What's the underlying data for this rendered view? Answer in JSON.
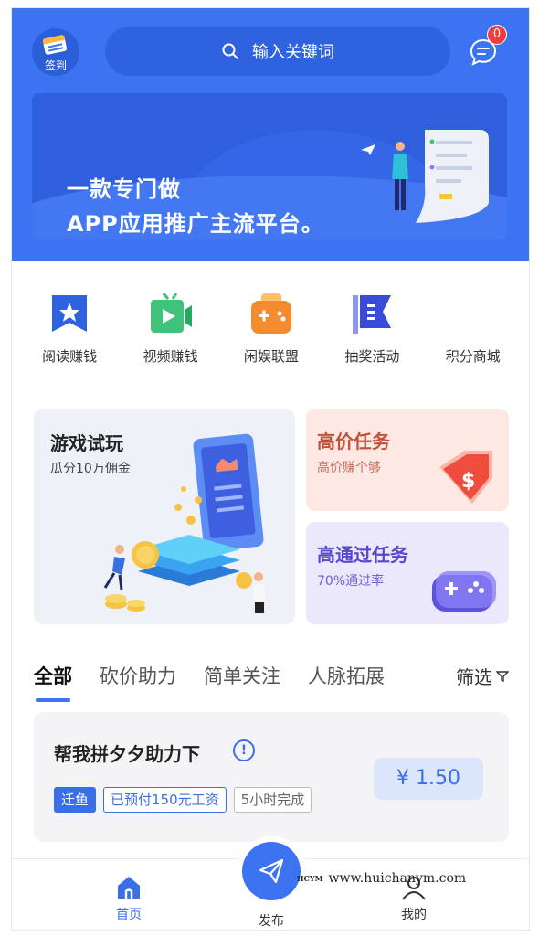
{
  "header": {
    "checkin_label": "签到",
    "search_placeholder": "输入关键词",
    "message_badge": "0"
  },
  "banner": {
    "line1": "一款专门做",
    "line2": "APP应用推广主流平台。"
  },
  "categories": [
    {
      "label": "阅读赚钱",
      "icon": "bookmark-star-icon",
      "color": "#2f62de"
    },
    {
      "label": "视频赚钱",
      "icon": "video-tv-icon",
      "color": "#3fc27a"
    },
    {
      "label": "闲娱联盟",
      "icon": "gamepad-icon",
      "color": "#f58b2f"
    },
    {
      "label": "抽奖活动",
      "icon": "flag-icon",
      "color": "#3a4cd6"
    },
    {
      "label": "积分商城",
      "icon": "",
      "color": ""
    }
  ],
  "promos": {
    "game": {
      "title": "游戏试玩",
      "subtitle": "瓜分10万佣金"
    },
    "high_price": {
      "title": "高价任务",
      "subtitle": "高价赚个够"
    },
    "high_pass": {
      "title": "高通过任务",
      "subtitle": "70%通过率"
    }
  },
  "tabs": {
    "items": [
      "全部",
      "砍价助力",
      "简单关注",
      "人脉拓展"
    ],
    "active": "全部",
    "filter_label": "筛选"
  },
  "task": {
    "title": "帮我拼夕夕助力下",
    "info_mark": "!",
    "tags": [
      "迁鱼",
      "已预付150元工资",
      "5小时完成"
    ],
    "price": "¥ 1.50"
  },
  "bottom_nav": {
    "home": "首页",
    "publish": "发布",
    "me": "我的"
  },
  "watermark": {
    "brand": "HCYM",
    "url": "www.huichanym.com"
  },
  "colors": {
    "primary": "#3b73f0",
    "price_bg": "#dbe6fb",
    "high_price_bg": "#fde8e3",
    "high_pass_bg": "#ece8fc"
  }
}
